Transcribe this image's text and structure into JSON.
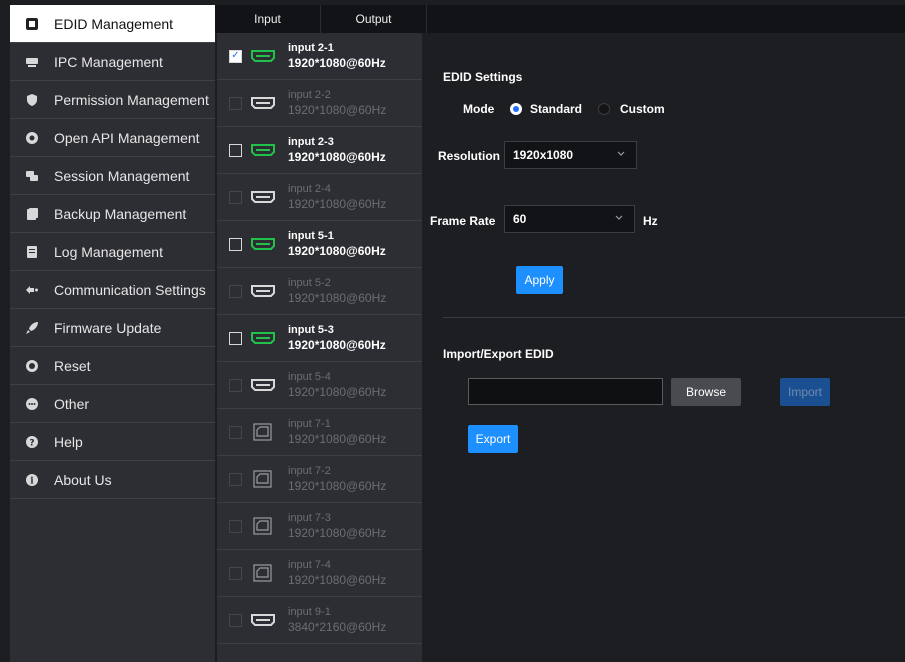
{
  "sidebar": {
    "items": [
      {
        "label": "EDID Management",
        "icon": "edid-icon",
        "active": true
      },
      {
        "label": "IPC Management",
        "icon": "ipc-icon"
      },
      {
        "label": "Permission Management",
        "icon": "shield-icon"
      },
      {
        "label": "Open API Management",
        "icon": "api-icon"
      },
      {
        "label": "Session Management",
        "icon": "session-icon"
      },
      {
        "label": "Backup Management",
        "icon": "backup-icon"
      },
      {
        "label": "Log Management",
        "icon": "log-icon"
      },
      {
        "label": "Communication Settings",
        "icon": "communication-icon"
      },
      {
        "label": "Firmware Update",
        "icon": "rocket-icon"
      },
      {
        "label": "Reset",
        "icon": "reset-icon"
      },
      {
        "label": "Other",
        "icon": "other-icon"
      },
      {
        "label": "Help",
        "icon": "help-icon"
      },
      {
        "label": "About Us",
        "icon": "info-icon"
      }
    ]
  },
  "tabs": {
    "input": "Input",
    "output": "Output"
  },
  "ports": [
    {
      "name": "input 2-1",
      "res": "1920*1080@60Hz",
      "state": "on",
      "checked": true,
      "type": "hdmi"
    },
    {
      "name": "input 2-2",
      "res": "1920*1080@60Hz",
      "state": "off",
      "checked": false,
      "type": "hdmi"
    },
    {
      "name": "input 2-3",
      "res": "1920*1080@60Hz",
      "state": "on",
      "checked": false,
      "type": "hdmi"
    },
    {
      "name": "input 2-4",
      "res": "1920*1080@60Hz",
      "state": "off",
      "checked": false,
      "type": "hdmi"
    },
    {
      "name": "input 5-1",
      "res": "1920*1080@60Hz",
      "state": "on",
      "checked": false,
      "type": "hdmi"
    },
    {
      "name": "input 5-2",
      "res": "1920*1080@60Hz",
      "state": "off",
      "checked": false,
      "type": "hdmi"
    },
    {
      "name": "input 5-3",
      "res": "1920*1080@60Hz",
      "state": "on",
      "checked": false,
      "type": "hdmi"
    },
    {
      "name": "input 5-4",
      "res": "1920*1080@60Hz",
      "state": "off",
      "checked": false,
      "type": "hdmi"
    },
    {
      "name": "input 7-1",
      "res": "1920*1080@60Hz",
      "state": "off",
      "checked": false,
      "type": "dp"
    },
    {
      "name": "input 7-2",
      "res": "1920*1080@60Hz",
      "state": "off",
      "checked": false,
      "type": "dp"
    },
    {
      "name": "input 7-3",
      "res": "1920*1080@60Hz",
      "state": "off",
      "checked": false,
      "type": "dp"
    },
    {
      "name": "input 7-4",
      "res": "1920*1080@60Hz",
      "state": "off",
      "checked": false,
      "type": "dp"
    },
    {
      "name": "input 9-1",
      "res": "3840*2160@60Hz",
      "state": "off",
      "checked": false,
      "type": "hdmi"
    }
  ],
  "edid": {
    "title": "EDID Settings",
    "mode_label": "Mode",
    "mode_standard": "Standard",
    "mode_custom": "Custom",
    "resolution_label": "Resolution",
    "resolution_value": "1920x1080",
    "framerate_label": "Frame Rate",
    "framerate_value": "60",
    "framerate_unit": "Hz",
    "apply": "Apply"
  },
  "import_export": {
    "title": "Import/Export EDID",
    "file_value": "",
    "browse": "Browse",
    "import": "Import",
    "export": "Export"
  },
  "colors": {
    "accent": "#1e8fff",
    "port_active": "#22c24a",
    "sidebar_bg": "#2d2e33",
    "page_bg": "#1d1e22"
  }
}
